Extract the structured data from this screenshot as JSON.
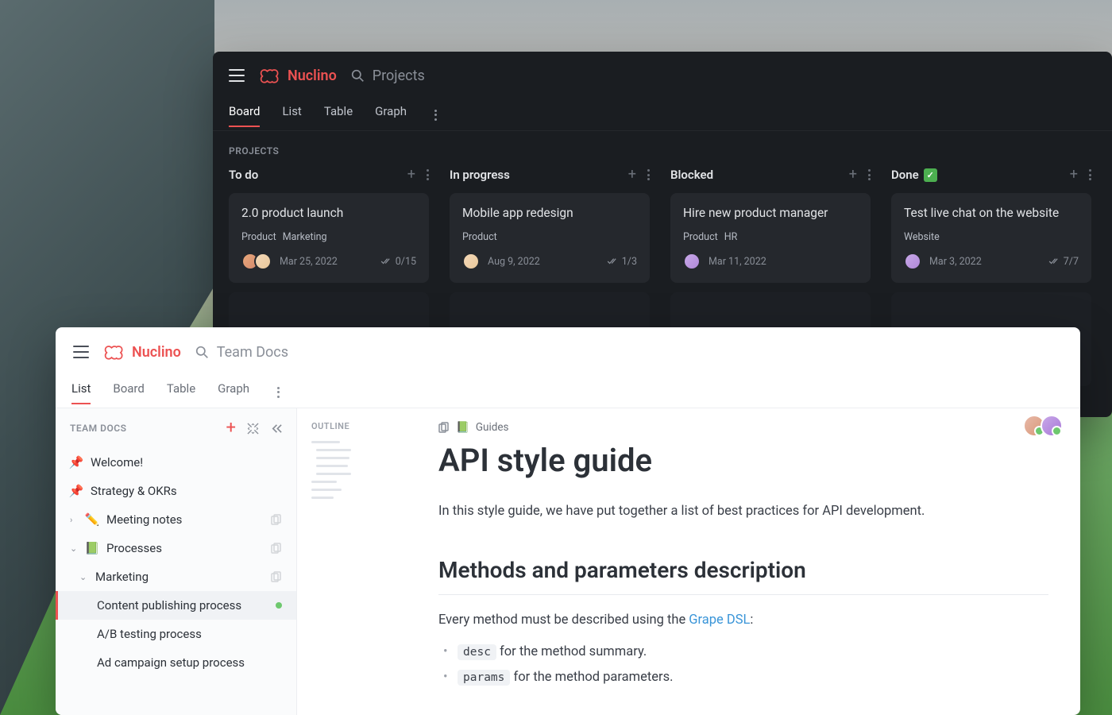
{
  "app_name": "Nuclino",
  "accent": "#ec5252",
  "dark": {
    "search_placeholder": "Projects",
    "tabs": [
      "Board",
      "List",
      "Table",
      "Graph"
    ],
    "active_tab": "Board",
    "section_label": "PROJECTS",
    "columns": [
      {
        "title": "To do",
        "cards": [
          {
            "title": "2.0 product launch",
            "tags": [
              "Product",
              "Marketing"
            ],
            "avatars": [
              "a",
              "b"
            ],
            "date": "Mar 25, 2022",
            "progress": "0/15"
          }
        ]
      },
      {
        "title": "In progress",
        "cards": [
          {
            "title": "Mobile app redesign",
            "tags": [
              "Product"
            ],
            "avatars": [
              "b"
            ],
            "date": "Aug 9, 2022",
            "progress": "1/3"
          }
        ]
      },
      {
        "title": "Blocked",
        "cards": [
          {
            "title": "Hire new product manager",
            "tags": [
              "Product",
              "HR"
            ],
            "avatars": [
              "c"
            ],
            "date": "Mar 11, 2022",
            "progress": ""
          }
        ]
      },
      {
        "title": "Done",
        "done_badge": true,
        "cards": [
          {
            "title": "Test live chat on the website",
            "tags": [
              "Website"
            ],
            "avatars": [
              "c"
            ],
            "date": "Mar 3, 2022",
            "progress": "7/7"
          }
        ]
      }
    ]
  },
  "light": {
    "search_placeholder": "Team Docs",
    "tabs": [
      "List",
      "Board",
      "Table",
      "Graph"
    ],
    "active_tab": "List",
    "sidebar_title": "TEAM DOCS",
    "tree": [
      {
        "icon": "pin",
        "label": "Welcome!",
        "depth": 0
      },
      {
        "icon": "pin",
        "label": "Strategy & OKRs",
        "depth": 0
      },
      {
        "icon": "pencil",
        "label": "Meeting notes",
        "depth": 0,
        "chev": "right",
        "copy": true
      },
      {
        "icon": "book",
        "label": "Processes",
        "depth": 0,
        "chev": "down",
        "copy": true
      },
      {
        "icon": "",
        "label": "Marketing",
        "depth": 1,
        "chev": "down",
        "copy": true
      },
      {
        "icon": "",
        "label": "Content publishing process",
        "depth": 2,
        "selected": true,
        "status": true
      },
      {
        "icon": "",
        "label": "A/B testing process",
        "depth": 2
      },
      {
        "icon": "",
        "label": "Ad campaign setup process",
        "depth": 2
      }
    ],
    "outline_label": "OUTLINE",
    "breadcrumb": {
      "book_label": "Guides"
    },
    "doc": {
      "title": "API style guide",
      "intro": "In this style guide, we have put together a list of best practices for API development.",
      "h2": "Methods and parameters description",
      "p_before_link": "Every method must be described using the ",
      "link_text": "Grape DSL",
      "p_after_link": ":",
      "bullets": [
        {
          "code": "desc",
          "rest": " for the method summary."
        },
        {
          "code": "params",
          "rest": " for the method parameters."
        }
      ]
    }
  }
}
